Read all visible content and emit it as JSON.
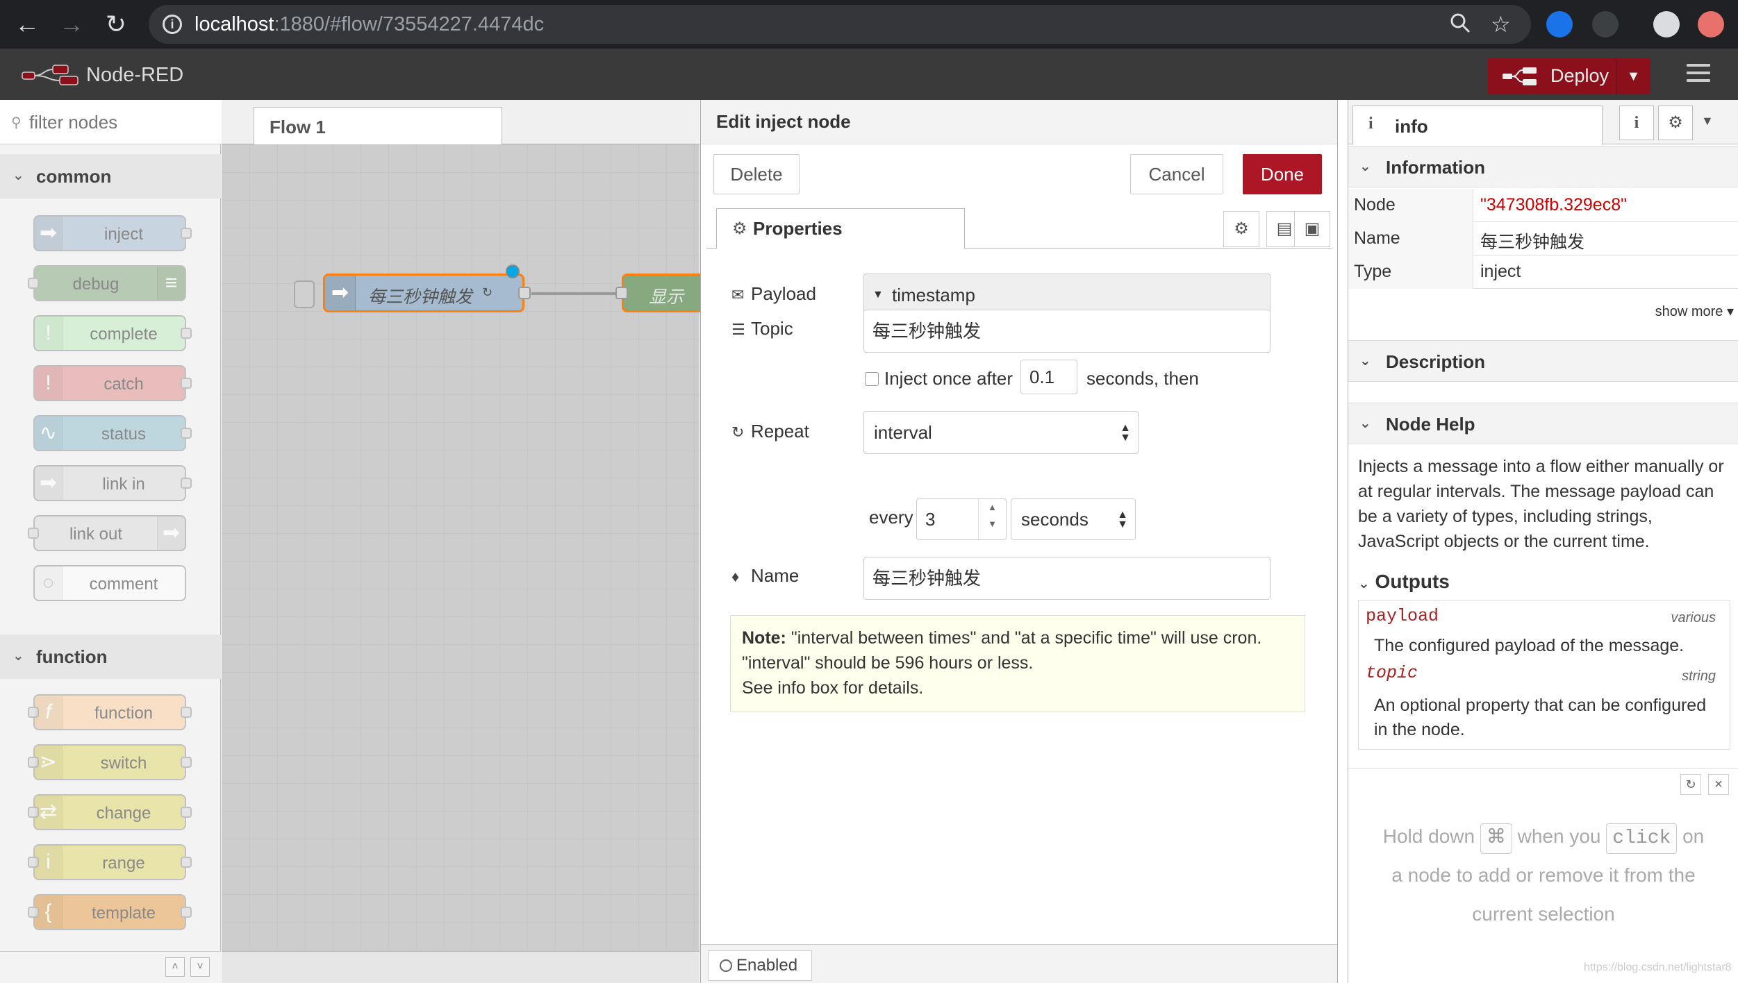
{
  "browser": {
    "url_host": "localhost",
    "url_rest": ":1880/#flow/73554227.4474dc"
  },
  "app": {
    "title": "Node-RED",
    "deploy_label": "Deploy"
  },
  "palette": {
    "filter_placeholder": "filter nodes",
    "categories": [
      {
        "label": "common",
        "nodes": [
          "inject",
          "debug",
          "complete",
          "catch",
          "status",
          "link in",
          "link out",
          "comment"
        ]
      },
      {
        "label": "function",
        "nodes": [
          "function",
          "switch",
          "change",
          "range",
          "template"
        ]
      }
    ]
  },
  "workspace": {
    "tab_label": "Flow 1",
    "inject_node_name": "每三秒钟触发",
    "debug_node_name": "显示"
  },
  "tray": {
    "title": "Edit inject node",
    "delete_label": "Delete",
    "cancel_label": "Cancel",
    "done_label": "Done",
    "tab_properties": "Properties",
    "payload_label": "Payload",
    "payload_value": "timestamp",
    "topic_label": "Topic",
    "topic_value": "每三秒钟触发",
    "inject_once_label": "Inject once after",
    "inject_once_value": "0.1",
    "seconds_then": "seconds, then",
    "repeat_label": "Repeat",
    "repeat_value": "interval",
    "every_label": "every",
    "every_value": "3",
    "units_value": "seconds",
    "name_label": "Name",
    "name_value": "每三秒钟触发",
    "note_bold": "Note:",
    "note_line1": " \"interval between times\" and \"at a specific time\" will use cron.",
    "note_line2": "\"interval\" should be 596 hours or less.",
    "note_line3": "See info box for details.",
    "enabled_label": "Enabled"
  },
  "sidebar": {
    "tab_label": "info",
    "information_header": "Information",
    "props": [
      {
        "key": "Node",
        "value": "\"347308fb.329ec8\""
      },
      {
        "key": "Name",
        "value": "每三秒钟触发"
      },
      {
        "key": "Type",
        "value": "inject"
      }
    ],
    "show_more": "show more",
    "description_header": "Description",
    "node_help_header": "Node Help",
    "help_text": "Injects a message into a flow either manually or at regular intervals. The message payload can be a variety of types, including strings, JavaScript objects or the current time.",
    "outputs_header": "Outputs",
    "outputs": [
      {
        "name": "payload",
        "type": "various",
        "desc": "The configured payload of the message."
      },
      {
        "name": "topic",
        "type": "string",
        "desc": "An optional property that can be configured in the node."
      }
    ],
    "hint_a": "Hold down",
    "hint_key": "⌘",
    "hint_b": "when you",
    "hint_click": "click",
    "hint_c": "on",
    "hint_d": "a node to add or remove it from the",
    "hint_e": "current selection"
  },
  "watermark": "https://blog.csdn.net/lightstar8"
}
